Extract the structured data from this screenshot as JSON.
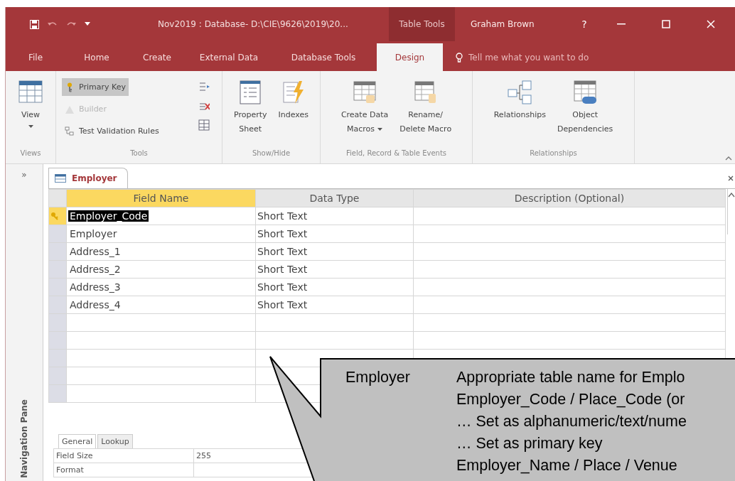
{
  "title_bar": {
    "title": "Nov2019 : Database- D:\\CIE\\9626\\2019\\20...",
    "context_tab": "Table Tools",
    "user": "Graham Brown",
    "help": "?"
  },
  "ribbon_tabs": [
    {
      "label": "File",
      "selected": false
    },
    {
      "label": "Home",
      "selected": false
    },
    {
      "label": "Create",
      "selected": false
    },
    {
      "label": "External Data",
      "selected": false
    },
    {
      "label": "Database Tools",
      "selected": false
    },
    {
      "label": "Design",
      "selected": true
    }
  ],
  "tell_me": {
    "placeholder": "Tell me what you want to do"
  },
  "ribbon_groups": [
    {
      "label": "Views",
      "items": [
        {
          "kind": "large",
          "lines": [
            "View"
          ],
          "caret": true
        }
      ]
    },
    {
      "label": "Tools",
      "items": [
        {
          "kind": "small",
          "label": "Primary Key",
          "selected": true,
          "disabled": false
        },
        {
          "kind": "small",
          "label": "Builder",
          "selected": false,
          "disabled": true
        },
        {
          "kind": "small",
          "label": "Test Validation Rules",
          "selected": false,
          "disabled": false
        }
      ]
    },
    {
      "label": "Show/Hide",
      "items": [
        {
          "kind": "large",
          "lines": [
            "Property",
            "Sheet"
          ],
          "caret": false
        },
        {
          "kind": "large",
          "lines": [
            "Indexes"
          ],
          "caret": false
        }
      ]
    },
    {
      "label": "Field, Record & Table Events",
      "items": [
        {
          "kind": "large",
          "lines": [
            "Create Data",
            "Macros"
          ],
          "caret": true
        },
        {
          "kind": "large",
          "lines": [
            "Rename/",
            "Delete Macro"
          ],
          "caret": false
        }
      ]
    },
    {
      "label": "Relationships",
      "items": [
        {
          "kind": "large",
          "lines": [
            "Relationships"
          ],
          "caret": false
        },
        {
          "kind": "large",
          "lines": [
            "Object",
            "Dependencies"
          ],
          "caret": false
        }
      ]
    }
  ],
  "navigation_pane": {
    "toggle": "»",
    "label": "Navigation Pane"
  },
  "document_tab": {
    "label": "Employer"
  },
  "table": {
    "columns": [
      "Field Name",
      "Data Type",
      "Description (Optional)"
    ],
    "rows": [
      {
        "field_name": "Employer_Code",
        "data_type": "Short Text",
        "primary_key": true,
        "selected": true
      },
      {
        "field_name": "Employer",
        "data_type": "Short Text",
        "primary_key": false,
        "selected": false
      },
      {
        "field_name": "Address_1",
        "data_type": "Short Text",
        "primary_key": false,
        "selected": false
      },
      {
        "field_name": "Address_2",
        "data_type": "Short Text",
        "primary_key": false,
        "selected": false
      },
      {
        "field_name": "Address_3",
        "data_type": "Short Text",
        "primary_key": false,
        "selected": false
      },
      {
        "field_name": "Address_4",
        "data_type": "Short Text",
        "primary_key": false,
        "selected": false
      }
    ]
  },
  "field_properties": {
    "tabs": [
      {
        "label": "General",
        "selected": true
      },
      {
        "label": "Lookup",
        "selected": false
      }
    ],
    "rows": [
      {
        "name": "Field Size",
        "value": "255"
      },
      {
        "name": "Format"
      }
    ]
  },
  "callout": {
    "heading": "Employer",
    "lines": [
      "Appropriate table name for Emplo",
      "Employer_Code / Place_Code (or",
      "… Set as alphanumeric/text/nume",
      "… Set as primary key",
      "Employer_Name / Place / Venue"
    ]
  }
}
